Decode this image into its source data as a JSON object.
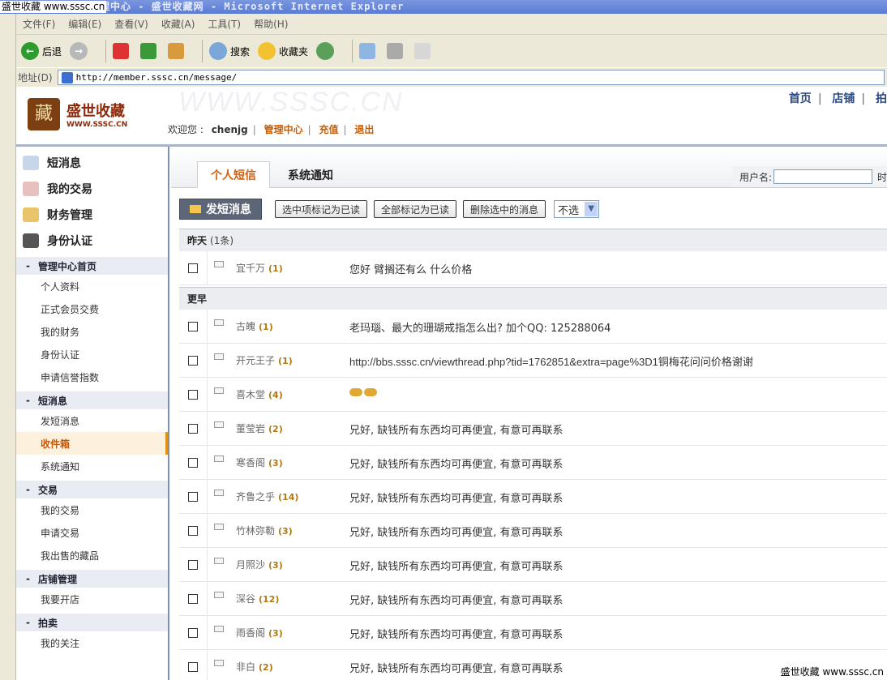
{
  "window": {
    "watermark_top": "盛世收藏 www.sssc.cn",
    "title": "管理中心 - 盛世收藏网 - Microsoft Internet Explorer"
  },
  "menubar": [
    "文件(F)",
    "编辑(E)",
    "查看(V)",
    "收藏(A)",
    "工具(T)",
    "帮助(H)"
  ],
  "toolbar": {
    "back": "后退",
    "search": "搜索",
    "favorites": "收藏夹"
  },
  "address": {
    "label": "地址(D)",
    "url": "http://member.sssc.cn/message/"
  },
  "header": {
    "logo_cn": "盛世收藏",
    "logo_en": "WWW.SSSC.CN",
    "watermark": "WWW.SSSC.CN",
    "welcome": "欢迎您 :",
    "username": "chenjg",
    "links": [
      "管理中心",
      "充值",
      "退出"
    ],
    "topnav": [
      "首页",
      "店铺",
      "拍"
    ]
  },
  "sidebar": {
    "top": [
      "短消息",
      "我的交易",
      "财务管理",
      "身份认证"
    ],
    "groups": [
      {
        "title": "管理中心首页",
        "items": [
          "个人资料",
          "正式会员交费",
          "我的财务",
          "身份认证",
          "申请信誉指数"
        ]
      },
      {
        "title": "短消息",
        "items": [
          "发短消息",
          "收件箱",
          "系统通知"
        ]
      },
      {
        "title": "交易",
        "items": [
          "我的交易",
          "申请交易",
          "我出售的藏品"
        ]
      },
      {
        "title": "店铺管理",
        "items": [
          "我要开店"
        ]
      },
      {
        "title": "拍卖",
        "items": [
          "我的关注"
        ]
      }
    ],
    "active": "收件箱"
  },
  "tabs": {
    "active": "个人短信",
    "other": "系统通知"
  },
  "search": {
    "label": "用户名:",
    "cut": "时"
  },
  "actions": {
    "send": "发短消息",
    "mark_selected": "选中项标记为已读",
    "mark_all": "全部标记为已读",
    "delete_selected": "删除选中的消息",
    "select_value": "不选"
  },
  "sections": [
    {
      "title": "昨天",
      "count": "(1条)",
      "rows": [
        {
          "from": "宜千万",
          "n": "(1)",
          "msg": "您好  臂搁还有么  什么价格"
        }
      ]
    },
    {
      "title": "更早",
      "count": "",
      "rows": [
        {
          "from": "古魄",
          "n": "(1)",
          "msg": "老玛瑙、最大的珊瑚戒指怎么出? 加个QQ: 125288064"
        },
        {
          "from": "开元王子",
          "n": "(1)",
          "msg": "http://bbs.sssc.cn/viewthread.php?tid=1762851&extra=page%3D1铜梅花问问价格谢谢"
        },
        {
          "from": "喜木堂",
          "n": "(4)",
          "msg": ""
        },
        {
          "from": "董莹岩",
          "n": "(2)",
          "msg": "兄好, 缺钱所有东西均可再便宜, 有意可再联系"
        },
        {
          "from": "寒香阁",
          "n": "(3)",
          "msg": "兄好, 缺钱所有东西均可再便宜, 有意可再联系"
        },
        {
          "from": "齐鲁之乎",
          "n": "(14)",
          "msg": "兄好, 缺钱所有东西均可再便宜, 有意可再联系"
        },
        {
          "from": "竹林弥勒",
          "n": "(3)",
          "msg": "兄好, 缺钱所有东西均可再便宜, 有意可再联系"
        },
        {
          "from": "月照沙",
          "n": "(3)",
          "msg": "兄好, 缺钱所有东西均可再便宜, 有意可再联系"
        },
        {
          "from": "深谷",
          "n": "(12)",
          "msg": "兄好, 缺钱所有东西均可再便宜, 有意可再联系"
        },
        {
          "from": "雨香阁",
          "n": "(3)",
          "msg": "兄好, 缺钱所有东西均可再便宜, 有意可再联系"
        },
        {
          "from": "非白",
          "n": "(2)",
          "msg": "兄好, 缺钱所有东西均可再便宜, 有意可再联系"
        }
      ]
    }
  ],
  "watermark_bottom": "盛世收藏 www.sssc.cn"
}
